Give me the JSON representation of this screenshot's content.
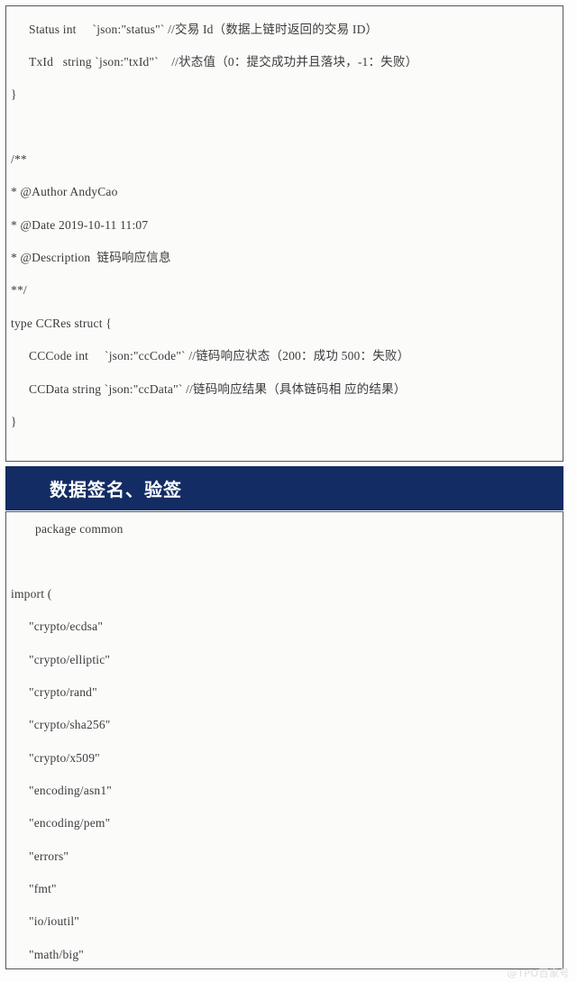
{
  "document": {
    "background_color": "#fdfdfd",
    "code_text_color": "#3b3b3d",
    "block_border_color": "#58585a",
    "block_background_color": "#fbfbfa",
    "banner_color": "#132c63",
    "banner_text_color": "#ffffff"
  },
  "block_one": {
    "lines": [
      "  Status int     `json:\"status\"` //交易 Id（数据上链时返回的交易 ID）",
      "  TxId   string `json:\"txId\"`    //状态值（0：提交成功并且落块，-1：失败）",
      "}",
      "/**",
      "* @Author AndyCao",
      "* @Date 2019-10-11 11:07",
      "* @Description  链码响应信息",
      "**/",
      "type CCRes struct {",
      "  CCCode int     `json:\"ccCode\"` //链码响应状态（200：成功 500：失败）",
      "  CCData string `json:\"ccData\"` //链码响应结果（具体链码相 应的结果）",
      "}"
    ],
    "line_1_status": "Status int     `json:\"status\"` //交易 Id（数据上链时返回的交易 ID）",
    "line_2_txid": "TxId   string `json:\"txId\"`    //状态值（0：提交成功并且落块，-1：失败）",
    "line_3_close_brace": "}",
    "line_4_comment_open": "/**",
    "line_5_author": "* @Author AndyCao",
    "line_6_date": "* @Date 2019-10-11 11:07",
    "line_7_description": "* @Description  链码响应信息",
    "line_8_comment_close": "**/",
    "line_9_type_decl": "type CCRes struct {",
    "line_10_cccode": "CCCode int     `json:\"ccCode\"` //链码响应状态（200：成功 500：失败）",
    "line_11_ccdata": "CCData string `json:\"ccData\"` //链码响应结果（具体链码相 应的结果）",
    "line_12_close_brace": "}"
  },
  "banner": {
    "title": "数据签名、验签"
  },
  "block_two": {
    "package_line": "package common",
    "import_open": "import (",
    "imports": [
      "\"crypto/ecdsa\"",
      "\"crypto/elliptic\"",
      "\"crypto/rand\"",
      "\"crypto/sha256\"",
      "\"crypto/x509\"",
      "\"encoding/asn1\"",
      "\"encoding/pem\"",
      "\"errors\"",
      "\"fmt\"",
      "\"io/ioutil\"",
      "\"math/big\""
    ]
  },
  "watermark": {
    "text": "@TPO百家号"
  }
}
